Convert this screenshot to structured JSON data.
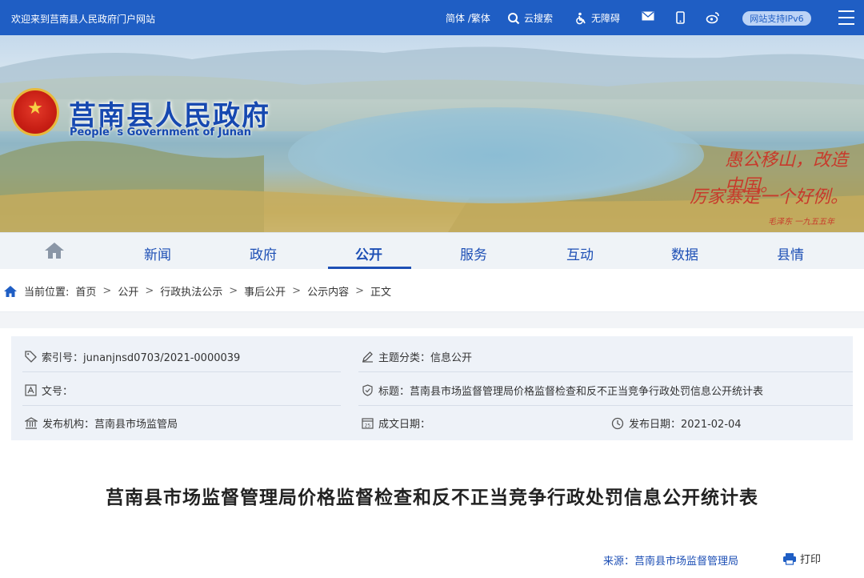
{
  "topbar": {
    "welcome": "欢迎来到莒南县人民政府门户网站",
    "lang": "简体 /繁体",
    "search": "云搜索",
    "accessibility": "无障碍",
    "ipv6": "网站支持IPv6"
  },
  "banner": {
    "title": "莒南县人民政府",
    "subtitle": "People’ s Government of Junan",
    "calligraphy_line1": "愚公移山，改造中国。",
    "calligraphy_line2": "厉家寨是一个好例。",
    "calligraphy_sign": "毛泽东 一九五五年"
  },
  "nav": {
    "items": [
      "新闻",
      "政府",
      "公开",
      "服务",
      "互动",
      "数据",
      "县情"
    ],
    "active": "公开"
  },
  "breadcrumb": {
    "label": "当前位置:",
    "items": [
      "首页",
      "公开",
      "行政执法公示",
      "事后公开",
      "公示内容",
      "正文"
    ],
    "separator": ">"
  },
  "info": {
    "index_no": "索引号：junanjnsd0703/2021-0000039",
    "topic": "主题分类：信息公开",
    "doc_no": "文号：",
    "title": "标题：莒南县市场监督管理局价格监督检查和反不正当竞争行政处罚信息公开统计表",
    "publisher": "发布机构：莒南县市场监管局",
    "created": "成文日期：",
    "published": "发布日期：2021-02-04"
  },
  "document": {
    "title": "莒南县市场监督管理局价格监督检查和反不正当竞争行政处罚信息公开统计表",
    "source": "来源：莒南县市场监督管理局",
    "print": "打印"
  },
  "colors": {
    "primary": "#1f5ec4",
    "nav_text": "#1d4fb5",
    "info_bg": "#eef2f8"
  }
}
